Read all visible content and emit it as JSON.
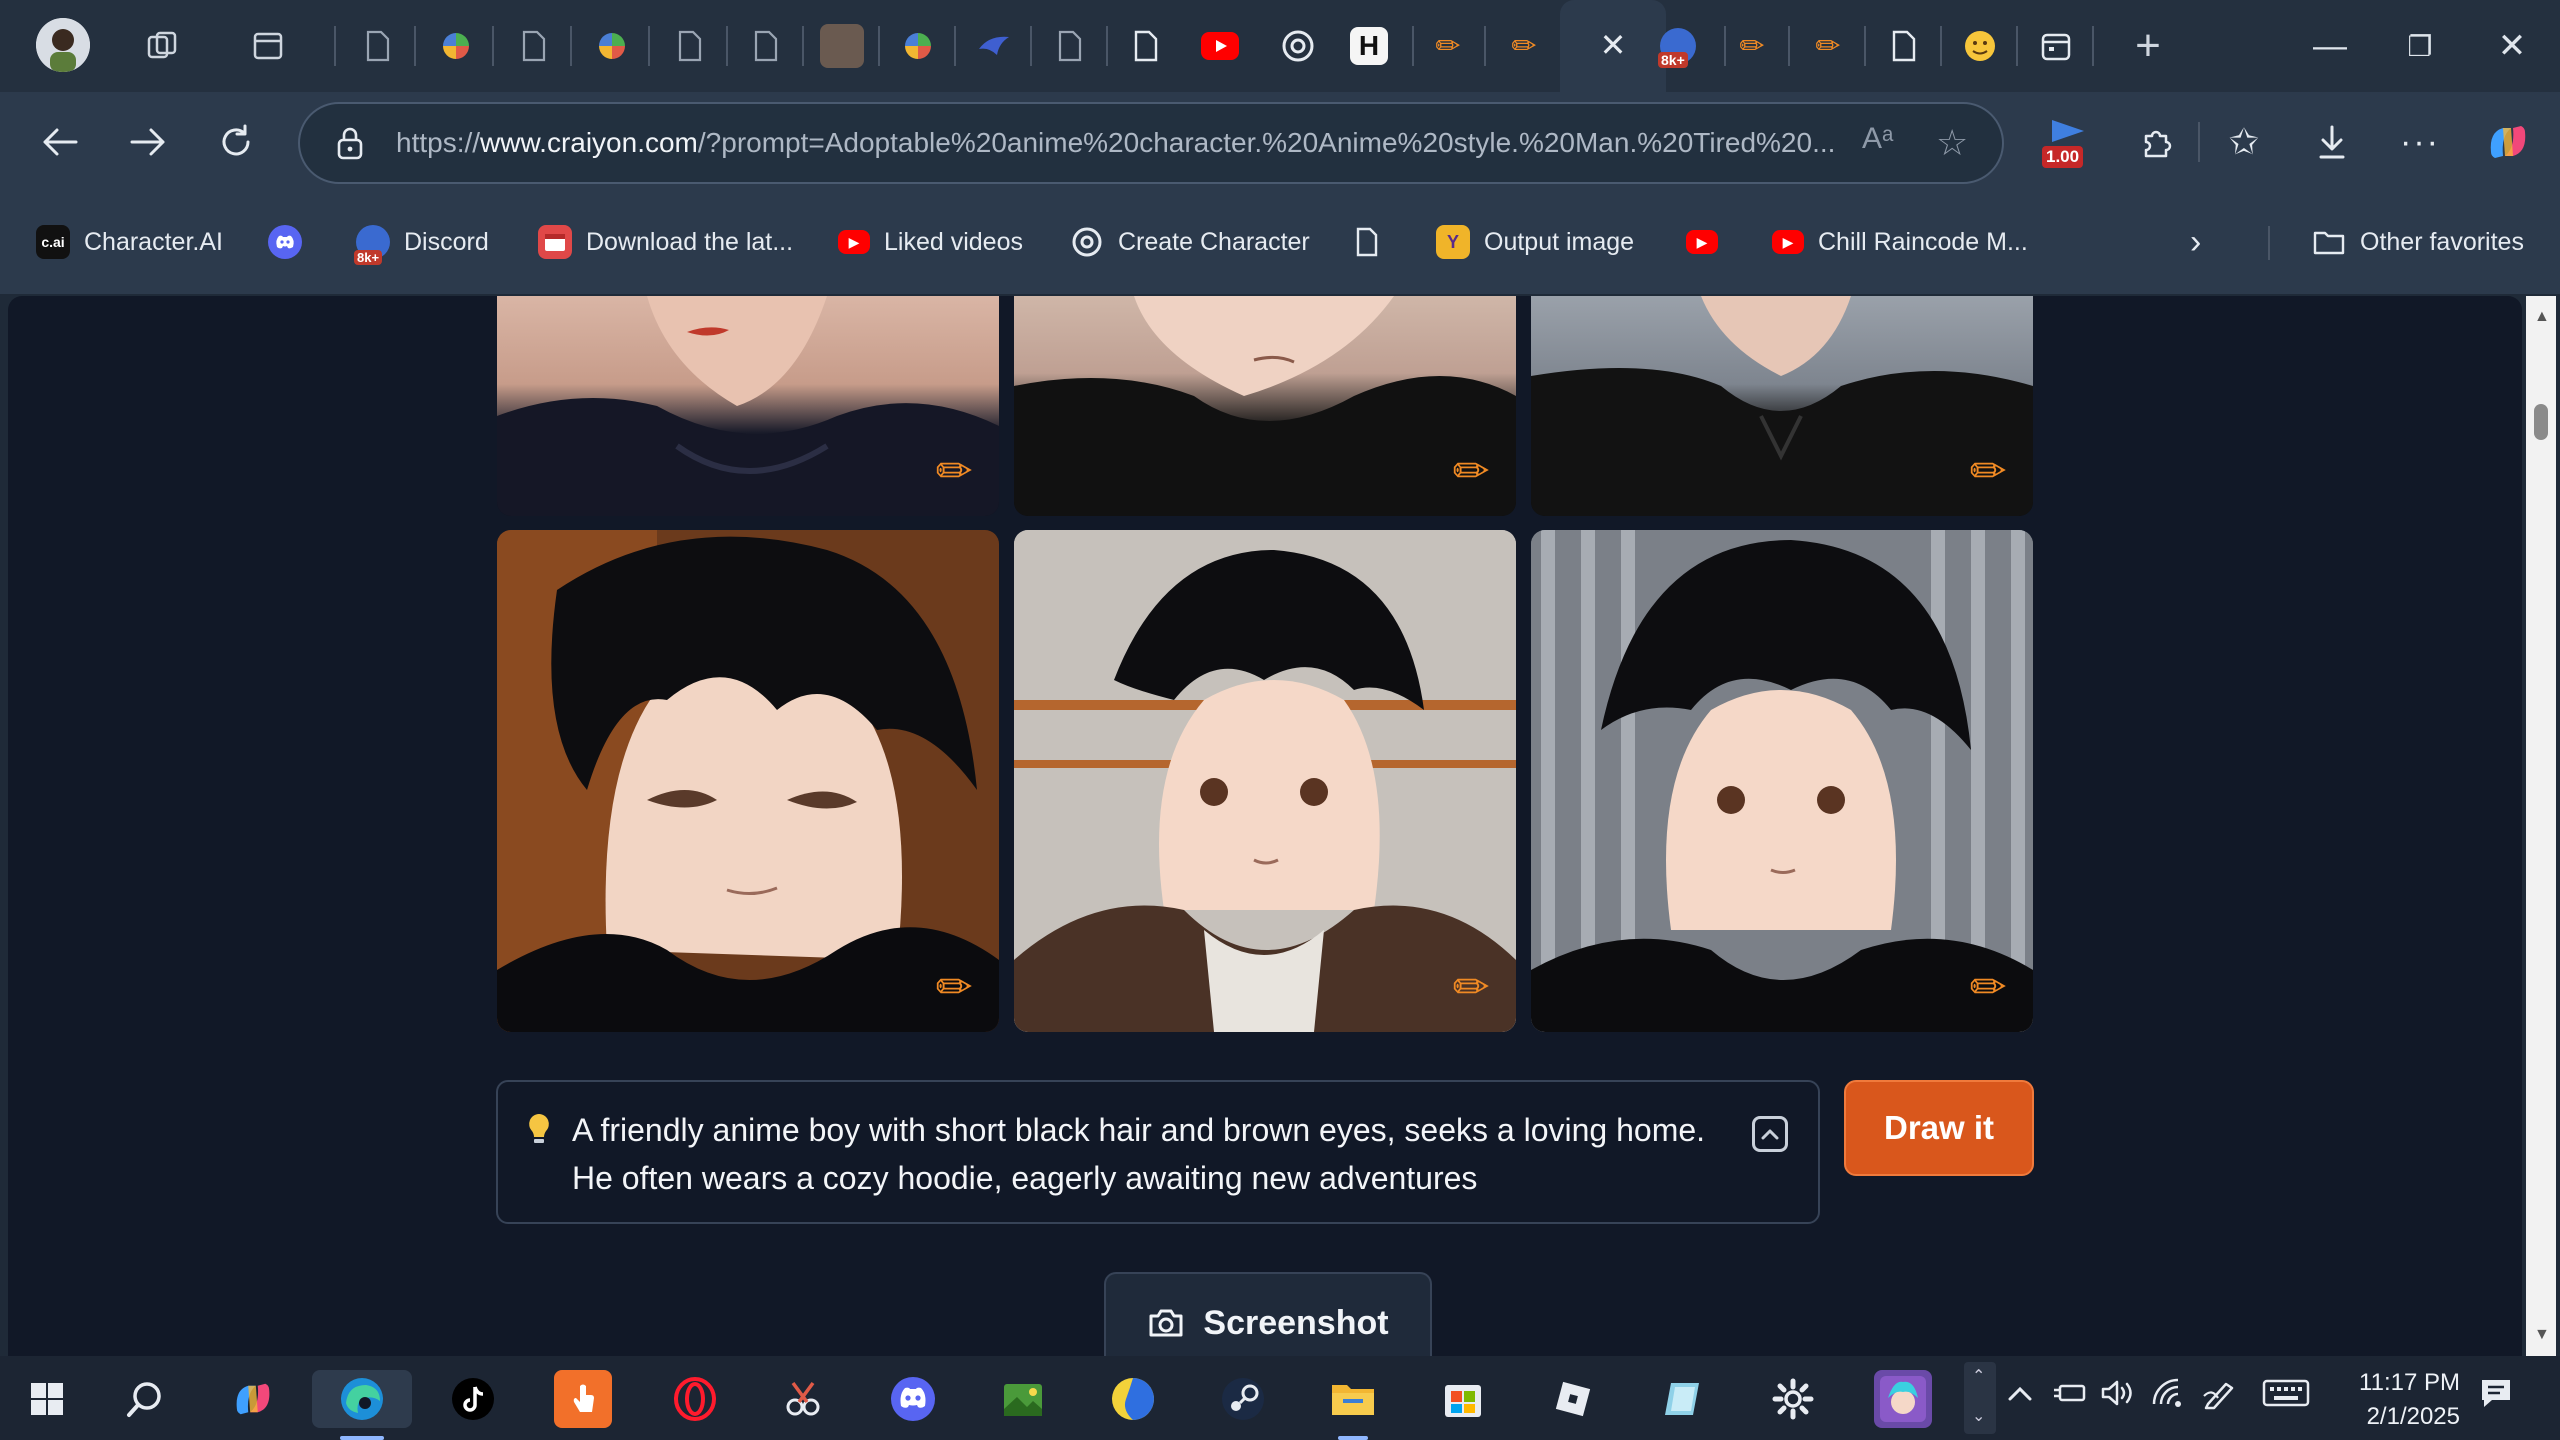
{
  "window": {
    "minimize_glyph": "—",
    "restore_glyph": "❐",
    "close_glyph": "✕"
  },
  "tabs": {
    "active_close_glyph": "✕",
    "new_tab_glyph": "+",
    "badge_8k": "8k+",
    "items": [
      {
        "icon": "user-avatar-icon"
      },
      {
        "icon": "workspaces-icon"
      },
      {
        "icon": "tab-actions-icon"
      },
      {
        "icon": "page-icon"
      },
      {
        "icon": "pinwheel-icon"
      },
      {
        "icon": "page-icon"
      },
      {
        "icon": "pinwheel-icon"
      },
      {
        "icon": "page-icon"
      },
      {
        "icon": "page-icon"
      },
      {
        "icon": "image-thumb-icon"
      },
      {
        "icon": "pinwheel-icon"
      },
      {
        "icon": "bird-icon"
      },
      {
        "icon": "page-icon"
      },
      {
        "icon": "page-icon"
      },
      {
        "icon": "youtube-icon"
      },
      {
        "icon": "openai-icon"
      },
      {
        "icon": "h-logo-icon"
      },
      {
        "icon": "pencil-icon"
      },
      {
        "icon": "pencil-icon"
      },
      {
        "icon": "discord-8k-icon"
      },
      {
        "icon": "pencil-icon"
      },
      {
        "icon": "pencil-icon"
      },
      {
        "icon": "page-icon"
      },
      {
        "icon": "emoji-icon"
      },
      {
        "icon": "calendar-icon"
      }
    ]
  },
  "address_bar": {
    "url_prefix": "https://",
    "url_host": "www.craiyon.com",
    "url_rest": "/?prompt=Adoptable%20anime%20character.%20Anime%20style.%20Man.%20Tired%20...",
    "read_aloud_glyph": "Aᵃ",
    "extension_badge": "1.00"
  },
  "favorites": [
    {
      "label": "Character.AI",
      "icon_text": "c.ai",
      "color": "#111111"
    },
    {
      "label": "",
      "icon_text": "",
      "color": "#5865f2"
    },
    {
      "label": "Discord",
      "icon_text": "8k+",
      "color": "#c0392b"
    },
    {
      "label": "Download the lat...",
      "icon_text": "",
      "color": "#e04848"
    },
    {
      "label": "Liked videos",
      "icon_text": "▶",
      "color": "#ff0000"
    },
    {
      "label": "Create Character",
      "icon_text": "",
      "color": "#e6ebf1"
    },
    {
      "label": "",
      "icon_text": "",
      "color": "#e6ebf1"
    },
    {
      "label": "Output image",
      "icon_text": "Y",
      "color": "#f0b429"
    },
    {
      "label": "",
      "icon_text": "▶",
      "color": "#ff0000"
    },
    {
      "label": "Chill Raincode M...",
      "icon_text": "▶",
      "color": "#ff0000"
    }
  ],
  "favorites_more": "Other favorites",
  "prompt": {
    "text": "A friendly anime boy with short black hair and brown eyes, seeks a loving home. He often wears a cozy hoodie, eagerly awaiting new adventures"
  },
  "draw_button": "Draw it",
  "screenshot_button": "Screenshot",
  "taskbar": {
    "time": "11:17 PM",
    "date": "2/1/2025"
  },
  "colors": {
    "accent_orange": "#d9571c",
    "page_bg": "#111827",
    "chrome_bg": "#2c3a4c"
  }
}
